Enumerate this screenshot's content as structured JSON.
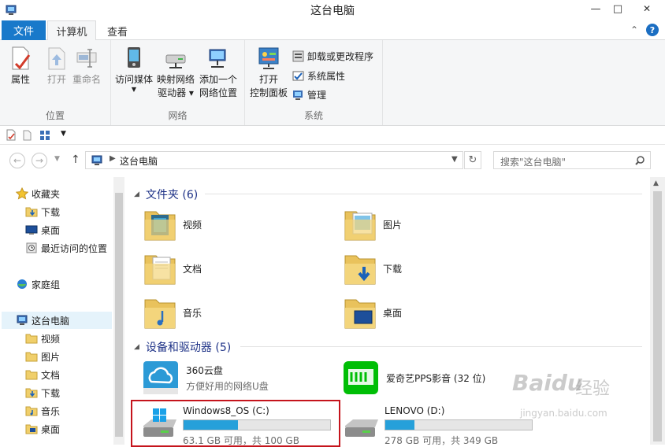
{
  "window": {
    "title": "这台电脑",
    "controls": {
      "minimize": "—",
      "maximize": "□",
      "close": "✕"
    }
  },
  "ribbon_tabs": {
    "file": "文件",
    "computer": "计算机",
    "view": "查看"
  },
  "ribbon": {
    "groups": {
      "location": {
        "label": "位置",
        "properties": "属性",
        "open": "打开",
        "rename": "重命名"
      },
      "network": {
        "label": "网络",
        "access_media": "访问媒体",
        "map_drive_line1": "映射网络",
        "map_drive_line2": "驱动器",
        "add_location_line1": "添加一个",
        "add_location_line2": "网络位置"
      },
      "system": {
        "label": "系统",
        "open_cp_line1": "打开",
        "open_cp_line2": "控制面板",
        "uninstall": "卸载或更改程序",
        "sys_props": "系统属性",
        "manage": "管理"
      }
    }
  },
  "address": {
    "path": "这台电脑",
    "search_placeholder": "搜索\"这台电脑\""
  },
  "nav": {
    "favorites": "收藏夹",
    "downloads": "下载",
    "desktop": "桌面",
    "recent": "最近访问的位置",
    "homegroup": "家庭组",
    "this_pc": "这台电脑",
    "pc_items": [
      "视频",
      "图片",
      "文档",
      "下载",
      "音乐",
      "桌面"
    ]
  },
  "content": {
    "folders_header": "文件夹 (6)",
    "folders": [
      "视频",
      "图片",
      "文档",
      "下载",
      "音乐",
      "桌面"
    ],
    "devices_header": "设备和驱动器 (5)",
    "cloud": {
      "name": "360云盘",
      "desc": "方便好用的网络U盘"
    },
    "iqiyi": {
      "name": "爱奇艺PPS影音 (32 位)"
    },
    "drive_c": {
      "name": "Windows8_OS (C:)",
      "info": "63.1 GB 可用，共 100 GB",
      "used_fraction": 0.37
    },
    "drive_d": {
      "name": "LENOVO (D:)",
      "info": "278 GB 可用，共 349 GB",
      "used_fraction": 0.2
    }
  },
  "watermark": {
    "brand": "Baidu",
    "suffix": "经验",
    "url": "jingyan.baidu.com"
  }
}
